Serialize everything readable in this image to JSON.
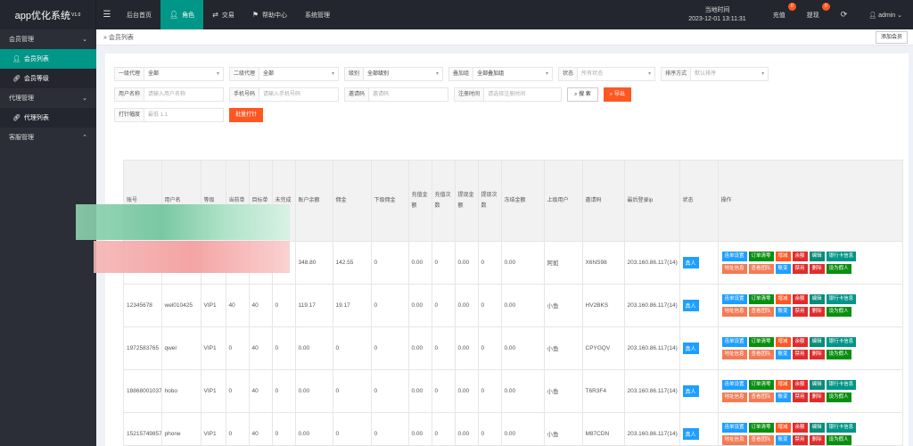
{
  "app": {
    "title": "app优化系统",
    "version": "V1.0"
  },
  "topnav": [
    {
      "label": "后台首页",
      "icon": "home-icon"
    },
    {
      "label": "角色",
      "icon": "user-icon"
    },
    {
      "label": "交易",
      "icon": "exchange-icon"
    },
    {
      "label": "帮助中心",
      "icon": "flag-icon"
    },
    {
      "label": "系统管理",
      "icon": ""
    }
  ],
  "top": {
    "time_label": "当地时间",
    "time": "2023-12-01 13:11:31",
    "recharge": "充值",
    "recharge_badge": "0",
    "withdraw": "提现",
    "withdraw_badge": "0",
    "user": "admin"
  },
  "sidebar": {
    "member_mgmt": "会员管理",
    "member_list": "会员列表",
    "member_level": "会员等级",
    "agent_mgmt": "代理管理",
    "agent_list": "代理列表",
    "cs_mgmt": "客服管理"
  },
  "crumb": "会员列表",
  "add_member": "添加会员",
  "filters": {
    "agent1_label": "一级代理",
    "agent1_value": "全部",
    "agent2_label": "二级代理",
    "agent2_value": "全部",
    "level_label": "级别",
    "level_value": "全部级别",
    "group_label": "叠加组",
    "group_value": "全部叠加组",
    "status_label": "状态",
    "status_value": "所有状态",
    "sort_label": "排序方式",
    "sort_value": "默认排序",
    "username_label": "用户名称",
    "username_ph": "请输入用户名称",
    "phone_label": "手机号码",
    "phone_ph": "请输入手机号码",
    "invite_label": "邀请码",
    "invite_ph": "邀请码",
    "regtime_label": "注册时间",
    "regtime_ph": "请选择注册时间",
    "search": "搜 索",
    "export": "导出",
    "pin_label": "打针幅度",
    "pin_ph": "最低 1.1",
    "batch_pin": "批量打针"
  },
  "columns": [
    "账号",
    "用户名",
    "等级",
    "当前单",
    "目标单",
    "未完成",
    "账户余额",
    "佣金",
    "下级佣金",
    "充值金额",
    "充值次数",
    "提现金额",
    "提现次数",
    "冻结金额",
    "上级用户",
    "邀请码",
    "最后登录ip",
    "状态",
    "操作"
  ],
  "ops": {
    "r1": [
      "连单设置",
      "订单清零",
      "增减",
      "余额",
      "编辑",
      "银行卡信息"
    ],
    "r2": [
      "地址信息",
      "查看团队",
      "账变",
      "禁用",
      "删除",
      "设为假人"
    ]
  },
  "rows": [
    [
      "",
      "",
      "",
      "",
      "",
      "",
      "348.80",
      "142.55",
      "0",
      "0.00",
      "0",
      "0.00",
      "0",
      "0.00",
      "阿如",
      "X6NS98",
      "203.160.86.117(14)",
      "真人"
    ],
    [
      "12345678",
      "wel010425",
      "VIP1",
      "40",
      "40",
      "0",
      "119.17",
      "19.17",
      "0",
      "0.00",
      "0",
      "0.00",
      "0",
      "0.00",
      "小鱼",
      "HV2BKS",
      "203.160.86.117(14)",
      "真人"
    ],
    [
      "1972583765",
      "qwer",
      "VIP1",
      "0",
      "40",
      "0",
      "0.00",
      "0",
      "0",
      "0.00",
      "0",
      "0.00",
      "0",
      "0.00",
      "小鱼",
      "CPYGQV",
      "203.160.86.117(14)",
      "真人"
    ],
    [
      "18868001037",
      "hobo",
      "VIP1",
      "0",
      "40",
      "0",
      "0.00",
      "0",
      "0",
      "0.00",
      "0",
      "0.00",
      "0",
      "0.00",
      "小鱼",
      "T6R3F4",
      "203.160.86.117(14)",
      "真人"
    ],
    [
      "15215749857",
      "phone",
      "VIP1",
      "0",
      "40",
      "0",
      "0.00",
      "0",
      "0",
      "0.00",
      "0",
      "0.00",
      "0",
      "0.00",
      "小鱼",
      "M87CDN",
      "203.160.86.117(14)",
      "真人"
    ]
  ]
}
